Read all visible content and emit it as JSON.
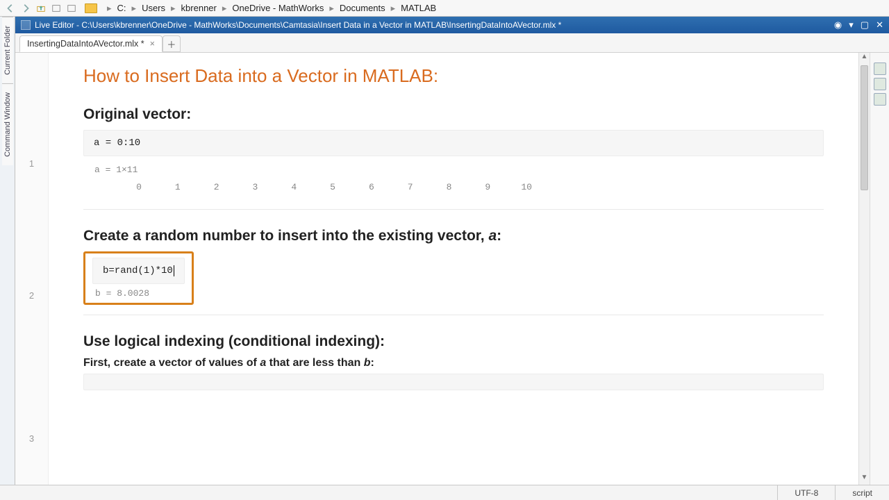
{
  "breadcrumb": [
    "C:",
    "Users",
    "kbrenner",
    "OneDrive - MathWorks",
    "Documents",
    "MATLAB"
  ],
  "left_tabs": {
    "current_folder": "Current Folder",
    "command_window": "Command Window"
  },
  "editor_title": "Live Editor - C:\\Users\\kbrenner\\OneDrive - MathWorks\\Documents\\Camtasia\\Insert Data in a Vector in MATLAB\\InsertingDataIntoAVector.mlx *",
  "doc_tab": {
    "label": "InsertingDataIntoAVector.mlx *"
  },
  "line_numbers": {
    "l1": "1",
    "l2": "2",
    "l3": "3"
  },
  "doc": {
    "title": "How to Insert Data into a Vector in MATLAB:",
    "sec1_heading": "Original vector:",
    "sec1_code": "a = 0:10",
    "sec1_out_label": "a = 1×11",
    "sec1_out_values": [
      "0",
      "1",
      "2",
      "3",
      "4",
      "5",
      "6",
      "7",
      "8",
      "9",
      "10"
    ],
    "sec2_heading_pre": "Create a random number to insert into the existing vector, ",
    "sec2_heading_em": "a",
    "sec2_heading_post": ":",
    "sec2_code": "b=rand(1)*10",
    "sec2_out": "b = 8.0028",
    "sec3_heading": "Use logical indexing (conditional indexing):",
    "sec3_sub_pre": "First, create a vector of values of ",
    "sec3_sub_em1": "a",
    "sec3_sub_mid": " that are less than ",
    "sec3_sub_em2": "b",
    "sec3_sub_post": ":"
  },
  "status": {
    "encoding": "UTF-8",
    "mode": "script"
  }
}
